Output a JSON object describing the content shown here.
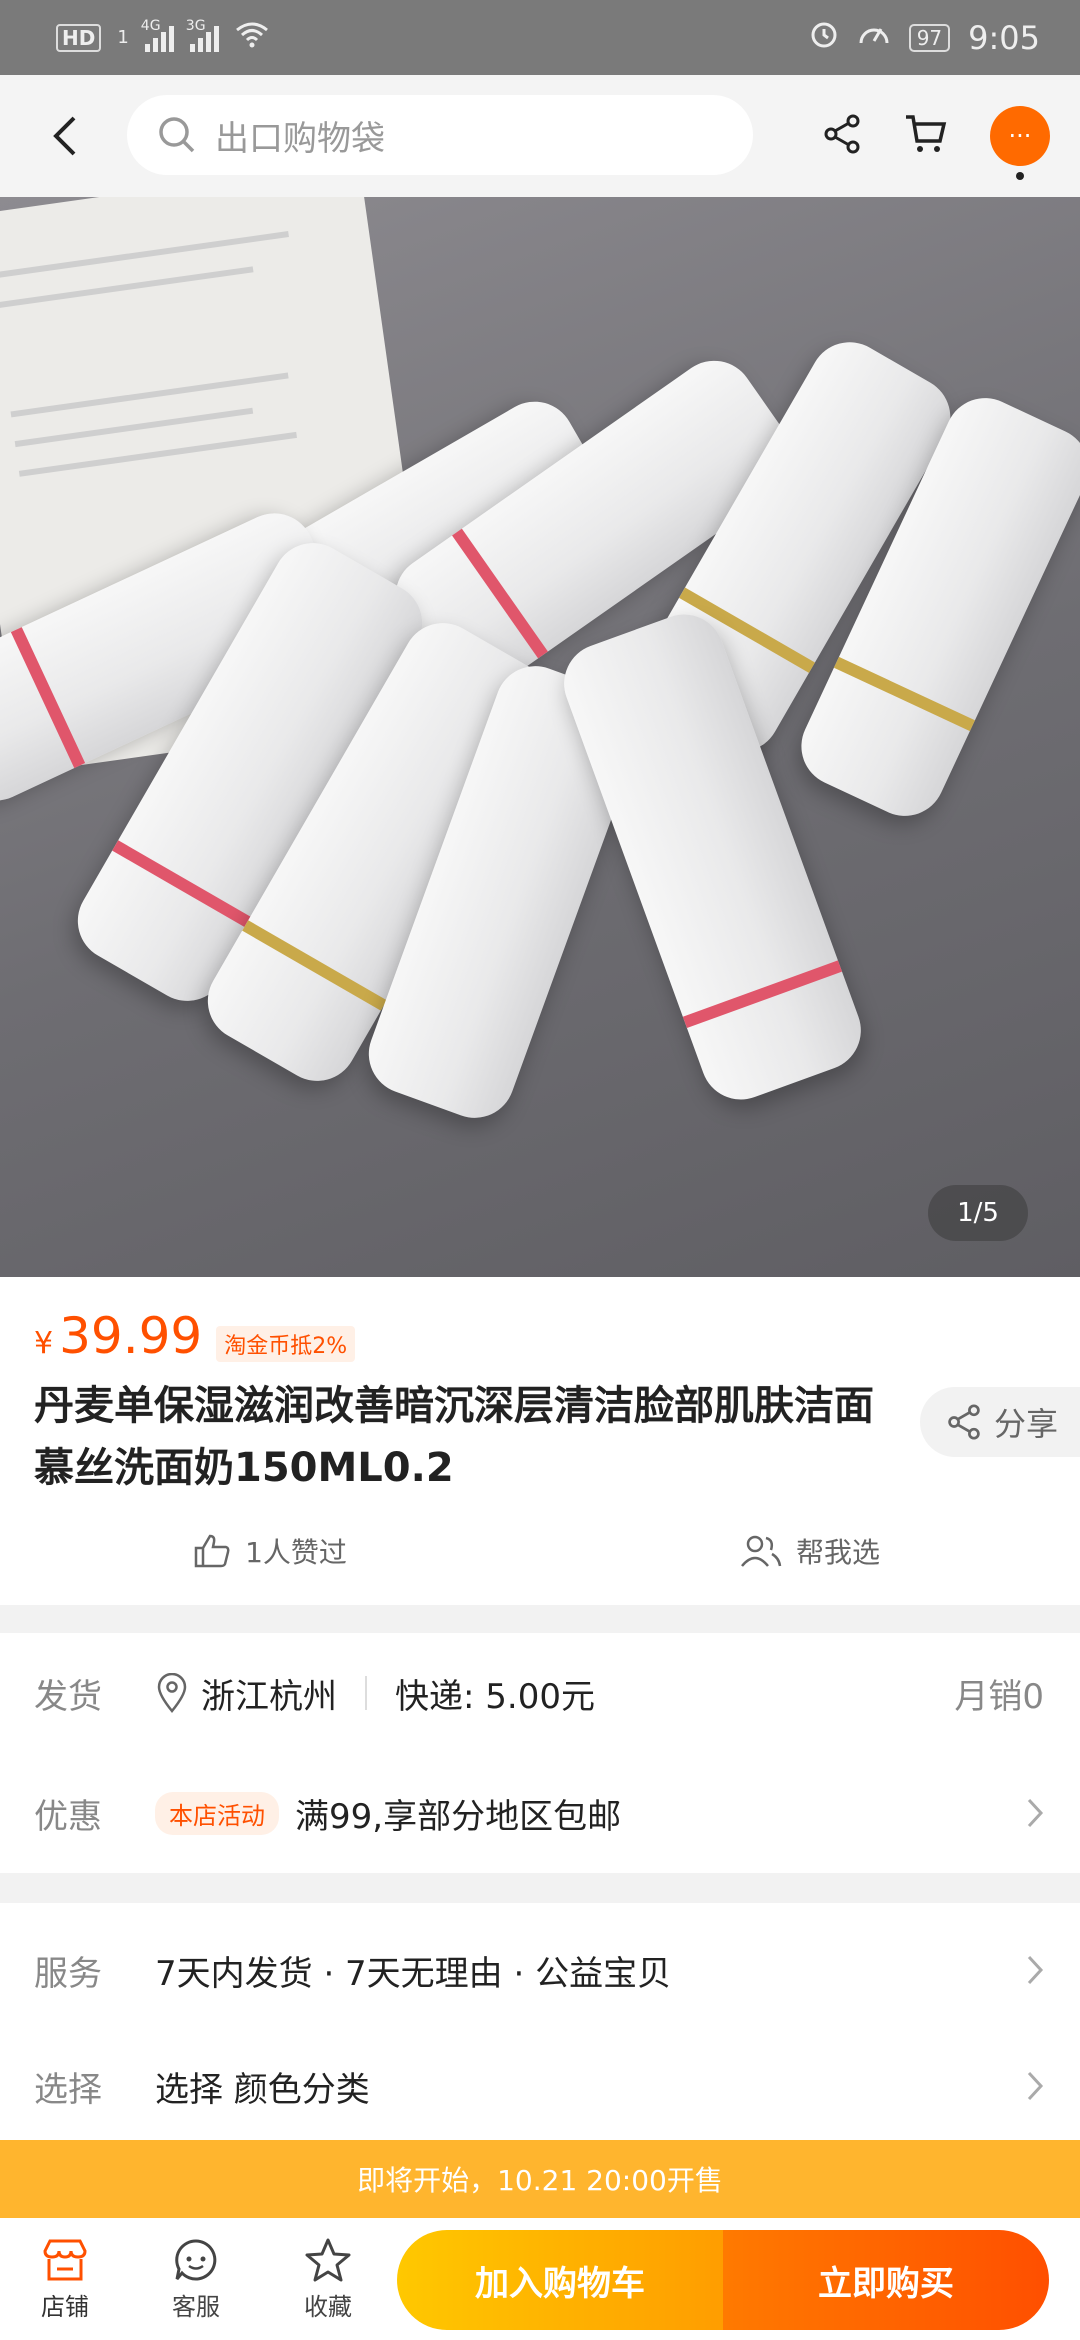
{
  "status_bar": {
    "hd": "HD",
    "sim1": "1",
    "net1": "4G",
    "net2": "3G",
    "battery": "97",
    "time": "9:05"
  },
  "top_bar": {
    "search_placeholder": "出口购物袋",
    "icons": [
      "back-icon",
      "search-icon",
      "share-icon",
      "cart-icon",
      "more-icon"
    ],
    "more_label": "···"
  },
  "gallery": {
    "indicator": "1/5"
  },
  "product": {
    "currency": "¥",
    "price": "39.99",
    "coin_badge": "淘金币抵2%",
    "title": "丹麦单保湿滋润改善暗沉深层清洁脸部肌肤洁面慕丝洗面奶150ML0.2",
    "share_label": "分享",
    "likes_label": "1人赞过",
    "help_choose_label": "帮我选"
  },
  "shipping": {
    "label": "发货",
    "location": "浙江杭州",
    "express": "快递: 5.00元",
    "monthly_sales": "月销0"
  },
  "promotion": {
    "label": "优惠",
    "tag": "本店活动",
    "text": "满99,享部分地区包邮"
  },
  "service": {
    "label": "服务",
    "text": "7天内发货 · 7天无理由 · 公益宝贝"
  },
  "select": {
    "label": "选择",
    "text": "选择 颜色分类"
  },
  "banner": {
    "text": "即将开始，10.21 20:00开售"
  },
  "bottom_bar": {
    "store": "店铺",
    "service": "客服",
    "favorite": "收藏",
    "add_to_cart": "加入购物车",
    "buy_now": "立即购买"
  },
  "colors": {
    "accent": "#ff5000",
    "banner": "#ffb52e",
    "cart_button": "#ffb000",
    "buy_button": "#ff5f00"
  }
}
